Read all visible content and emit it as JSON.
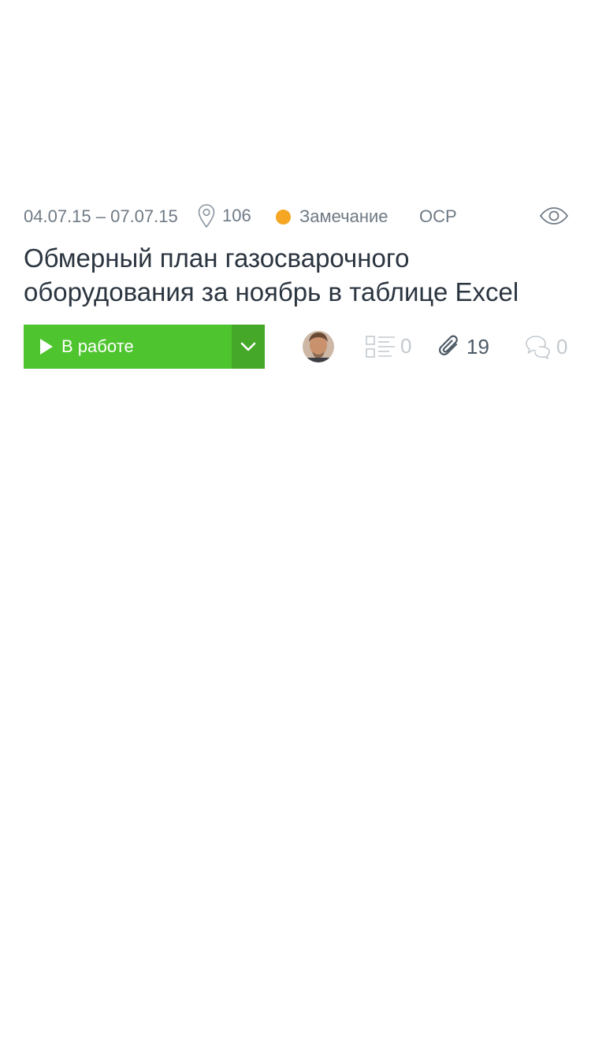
{
  "task": {
    "dates": "04.07.15 – 07.07.15",
    "location": "106",
    "type": "Замечание",
    "type_color": "#f5a623",
    "code": "ОСР",
    "title": "Обмерный план газосварочного оборудования за ноябрь в таблице Excel"
  },
  "status": {
    "label": "В работе",
    "color": "#4ec42f",
    "toggle_color": "#45a829"
  },
  "counters": {
    "checklist": "0",
    "attachments": "19",
    "comments": "0"
  },
  "icons": {
    "location": "pin-icon",
    "view": "eye-icon",
    "play": "play-icon",
    "dropdown": "chevron-down-icon",
    "checklist": "checklist-icon",
    "attachments": "paperclip-icon",
    "comments": "comments-icon"
  }
}
